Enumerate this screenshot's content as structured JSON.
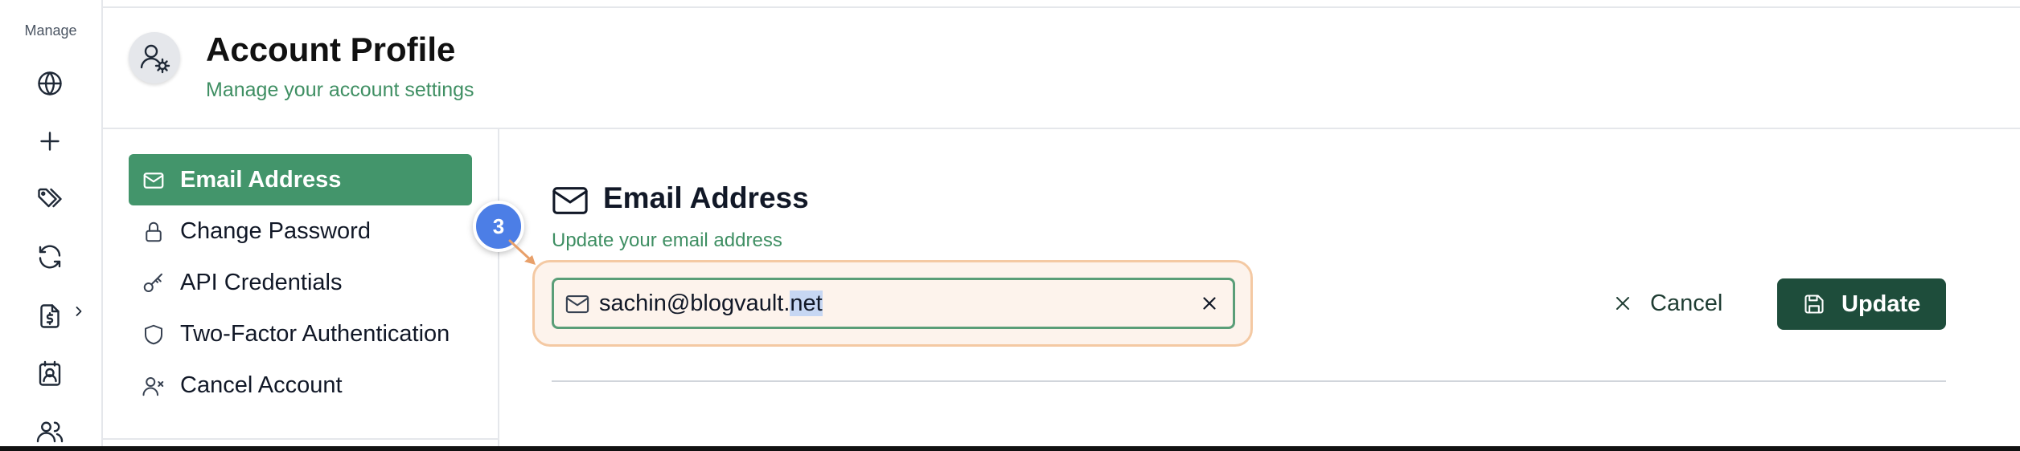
{
  "rail": {
    "label": "Manage",
    "icons": [
      "globe-icon",
      "plus-icon",
      "tags-icon",
      "refresh-icon",
      "file-dollar-icon",
      "contact-icon",
      "users-icon"
    ]
  },
  "header": {
    "title": "Account Profile",
    "subtitle": "Manage your account settings",
    "avatar_icon": "user-gear-icon"
  },
  "subnav": {
    "items": [
      {
        "label": "Email Address",
        "icon": "mail-icon",
        "active": true
      },
      {
        "label": "Change Password",
        "icon": "lock-icon",
        "active": false
      },
      {
        "label": "API Credentials",
        "icon": "key-icon",
        "active": false
      },
      {
        "label": "Two-Factor Authentication",
        "icon": "shield-icon",
        "active": false
      },
      {
        "label": "Cancel Account",
        "icon": "user-x-icon",
        "active": false
      }
    ]
  },
  "section": {
    "title": "Email Address",
    "subtitle": "Update your email address",
    "email_value_main": "sachin@blogvault.",
    "email_value_selected": "net"
  },
  "step_badge": "3",
  "actions": {
    "cancel_label": "Cancel",
    "update_label": "Update"
  },
  "colors": {
    "accent": "#43956b",
    "primary_button": "#1e4d3b",
    "highlight_bg": "#fdf3ec",
    "highlight_border": "#f4c9a3",
    "badge": "#4c7ee6"
  }
}
